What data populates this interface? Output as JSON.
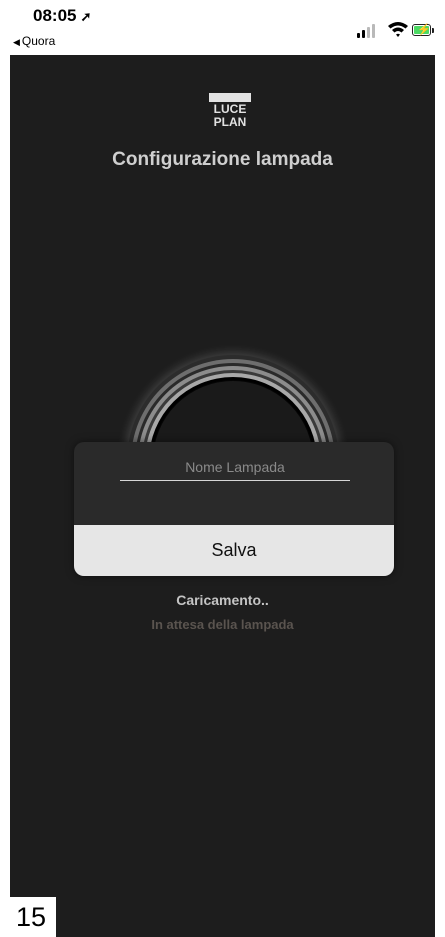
{
  "status_bar": {
    "time": "08:05",
    "location_arrow": "➚",
    "back_label": "Quora",
    "icons": [
      "signal-icon",
      "wifi-icon",
      "battery-charging-icon"
    ]
  },
  "app": {
    "logo": {
      "line1": "LUCE",
      "line2": "PLAN"
    },
    "title": "Configurazione lampada",
    "modal": {
      "name_placeholder": "Nome Lampada",
      "name_value": "",
      "save_label": "Salva"
    },
    "loading_text": "Caricamento..",
    "waiting_text": "In attesa della lampada"
  },
  "page_number": "15",
  "colors": {
    "background": "#1d1d1d",
    "modal": "#2a2a2a",
    "button": "#e6e6e6",
    "waiting_text": "#5a544f"
  }
}
